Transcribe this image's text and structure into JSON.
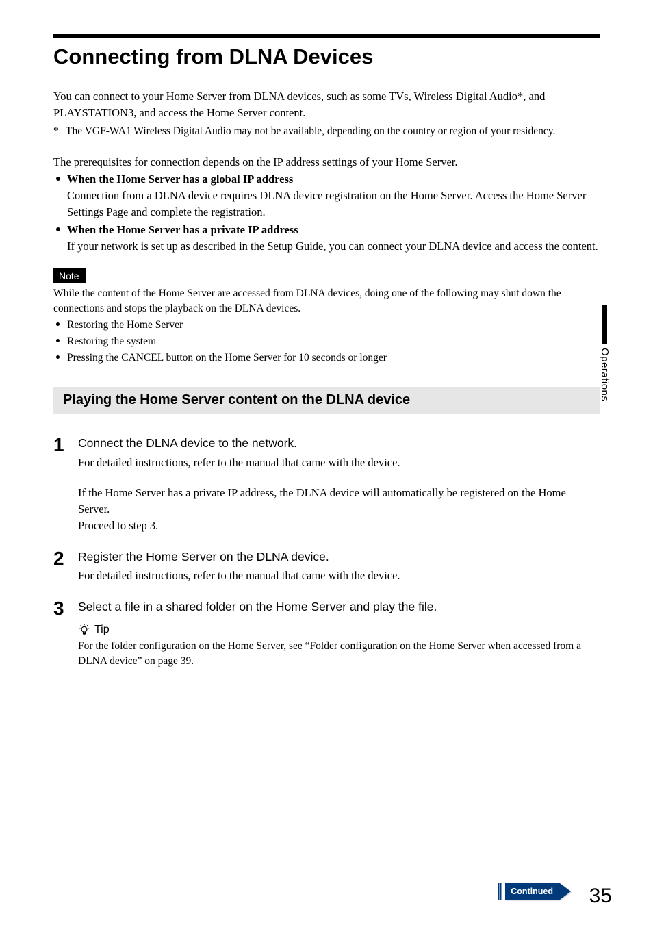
{
  "title": "Connecting from DLNA Devices",
  "intro": "You can connect to your Home Server from DLNA devices, such as some TVs, Wireless Digital Audio*, and PLAYSTATION3, and access the Home Server content.",
  "footnote_marker": "*",
  "footnote": "The VGF-WA1 Wireless Digital Audio may not be available, depending on the country or region of your residency.",
  "prereq_intro": "The prerequisites for connection depends on the IP address settings of your Home Server.",
  "conditions": [
    {
      "title": "When the Home Server has a global IP address",
      "body": "Connection from a DLNA device requires DLNA device registration on the Home Server. Access the Home Server Settings Page and complete the registration."
    },
    {
      "title": "When the Home Server has a private IP address",
      "body": "If your network is set up as described in the Setup Guide, you can connect your DLNA device and access the content."
    }
  ],
  "note_label": "Note",
  "note_intro": "While the content of the Home Server are accessed from DLNA devices, doing one of the following may shut down the connections and stops the playback on the DLNA devices.",
  "note_items": [
    "Restoring the Home Server",
    "Restoring the system",
    "Pressing the CANCEL button on the Home Server for 10 seconds or longer"
  ],
  "section_title": "Playing the Home Server content on the DLNA device",
  "steps": [
    {
      "num": "1",
      "heading": "Connect the DLNA device to the network.",
      "desc1": "For detailed instructions, refer to the manual that came with the device.",
      "desc2": "If the Home Server has a private IP address, the DLNA device will automatically be registered on the Home Server.",
      "desc3": "Proceed to step 3."
    },
    {
      "num": "2",
      "heading": "Register the Home Server on the DLNA device.",
      "desc1": "For detailed instructions, refer to the manual that came with the device."
    },
    {
      "num": "3",
      "heading": "Select a file in a shared folder on the Home Server and play the file.",
      "tip_label": "Tip",
      "tip_body": "For the folder configuration on the Home Server, see “Folder configuration on the Home Server when accessed from a DLNA device” on page 39."
    }
  ],
  "side_tab": "Operations",
  "continued_label": "Continued",
  "page_number": "35"
}
